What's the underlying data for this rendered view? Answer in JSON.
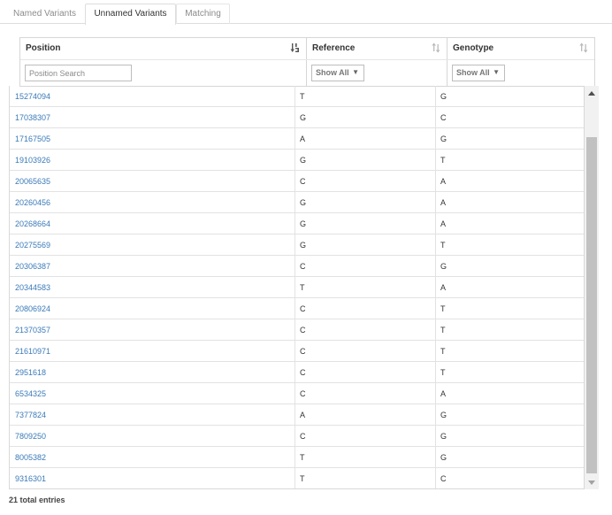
{
  "tabs": [
    {
      "label": "Named Variants",
      "active": false
    },
    {
      "label": "Unnamed Variants",
      "active": true
    },
    {
      "label": "Matching",
      "active": false
    }
  ],
  "columns": [
    {
      "label": "Position",
      "sort": "sort-numeric-asc-icon"
    },
    {
      "label": "Reference",
      "sort": "sort-icon"
    },
    {
      "label": "Genotype",
      "sort": "sort-icon"
    }
  ],
  "filters": {
    "position_placeholder": "Position Search",
    "reference_value": "Show All",
    "genotype_value": "Show All"
  },
  "rows": [
    {
      "position": "15274094",
      "reference": "T",
      "genotype": "G"
    },
    {
      "position": "17038307",
      "reference": "G",
      "genotype": "C"
    },
    {
      "position": "17167505",
      "reference": "A",
      "genotype": "G"
    },
    {
      "position": "19103926",
      "reference": "G",
      "genotype": "T"
    },
    {
      "position": "20065635",
      "reference": "C",
      "genotype": "A"
    },
    {
      "position": "20260456",
      "reference": "G",
      "genotype": "A"
    },
    {
      "position": "20268664",
      "reference": "G",
      "genotype": "A"
    },
    {
      "position": "20275569",
      "reference": "G",
      "genotype": "T"
    },
    {
      "position": "20306387",
      "reference": "C",
      "genotype": "G"
    },
    {
      "position": "20344583",
      "reference": "T",
      "genotype": "A"
    },
    {
      "position": "20806924",
      "reference": "C",
      "genotype": "T"
    },
    {
      "position": "21370357",
      "reference": "C",
      "genotype": "T"
    },
    {
      "position": "21610971",
      "reference": "C",
      "genotype": "T"
    },
    {
      "position": "2951618",
      "reference": "C",
      "genotype": "T"
    },
    {
      "position": "6534325",
      "reference": "C",
      "genotype": "A"
    },
    {
      "position": "7377824",
      "reference": "A",
      "genotype": "G"
    },
    {
      "position": "7809250",
      "reference": "C",
      "genotype": "G"
    },
    {
      "position": "8005382",
      "reference": "T",
      "genotype": "G"
    },
    {
      "position": "9316301",
      "reference": "T",
      "genotype": "C"
    }
  ],
  "footer": {
    "total": "21 total entries"
  },
  "colors": {
    "link": "#3a7ab8",
    "border": "#d6d6d6"
  }
}
